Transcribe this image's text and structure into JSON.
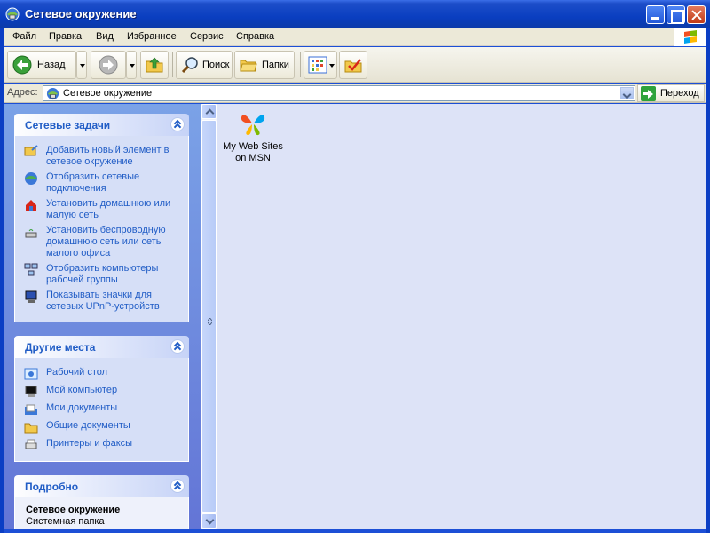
{
  "window": {
    "title": "Сетевое окружение"
  },
  "menu": {
    "items": [
      "Файл",
      "Правка",
      "Вид",
      "Избранное",
      "Сервис",
      "Справка"
    ]
  },
  "toolbar": {
    "back_label": "Назад",
    "search_label": "Поиск",
    "folders_label": "Папки"
  },
  "address": {
    "label": "Адрес:",
    "value": "Сетевое окружение",
    "go_label": "Переход"
  },
  "network_tasks": {
    "title": "Сетевые задачи",
    "items": [
      {
        "label": "Добавить новый элемент в сетевое окружение",
        "icon": "add-network-place-icon"
      },
      {
        "label": "Отобразить сетевые подключения",
        "icon": "network-connections-icon"
      },
      {
        "label": "Установить домашнюю или малую сеть",
        "icon": "home-network-icon"
      },
      {
        "label": "Установить беспроводную домашнюю сеть или сеть малого офиса",
        "icon": "wireless-network-icon"
      },
      {
        "label": "Отобразить компьютеры рабочей группы",
        "icon": "workgroup-computers-icon"
      },
      {
        "label": "Показывать значки для сетевых UPnP-устройств",
        "icon": "upnp-devices-icon"
      }
    ]
  },
  "other_places": {
    "title": "Другие места",
    "items": [
      {
        "label": "Рабочий стол",
        "icon": "desktop-icon"
      },
      {
        "label": "Мой компьютер",
        "icon": "my-computer-icon"
      },
      {
        "label": "Мои документы",
        "icon": "my-documents-icon"
      },
      {
        "label": "Общие документы",
        "icon": "shared-documents-icon"
      },
      {
        "label": "Принтеры и факсы",
        "icon": "printers-faxes-icon"
      }
    ]
  },
  "details": {
    "title": "Подробно",
    "name": "Сетевое окружение",
    "type": "Системная папка"
  },
  "content": {
    "items": [
      {
        "label": "My Web Sites on MSN",
        "icon": "msn-butterfly-icon"
      }
    ]
  },
  "colors": {
    "titlebar": "#0a3ec0",
    "task_pane": "#6f8ee0",
    "link": "#215dc6",
    "content_bg": "#dde3f7"
  }
}
